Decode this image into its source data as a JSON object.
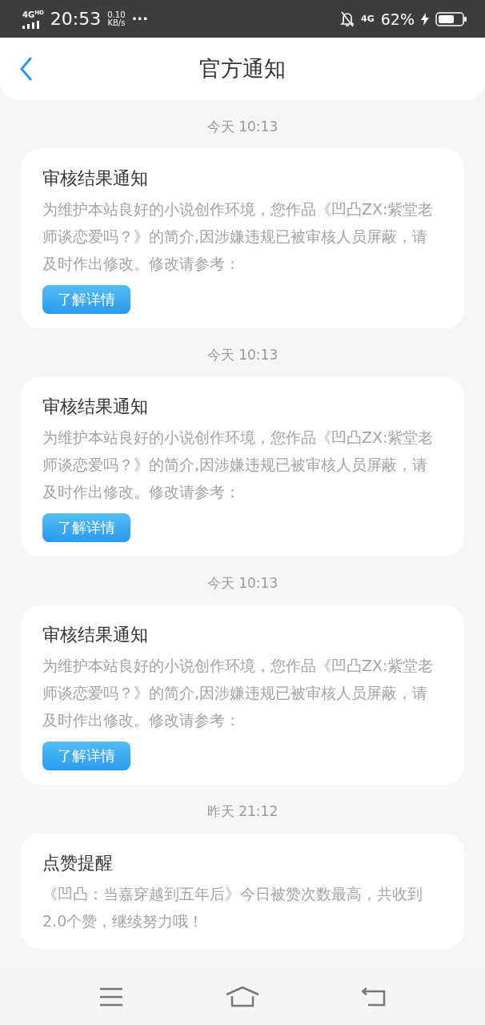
{
  "status_bar": {
    "network": "4G",
    "network_badge": "HD",
    "time": "20:53",
    "speed_value": "0.10",
    "speed_unit": "KB/s",
    "more": "···",
    "data_label": "4G",
    "battery": "62%"
  },
  "header": {
    "title": "官方通知"
  },
  "notifications": [
    {
      "time": "今天 10:13",
      "title": "审核结果通知",
      "body": "为维护本站良好的小说创作环境，您作品《凹凸ZX:紫堂老师谈恋爱吗？》的简介,因涉嫌违规已被审核人员屏蔽，请及时作出修改。修改请参考：",
      "button": "了解详情"
    },
    {
      "time": "今天 10:13",
      "title": "审核结果通知",
      "body": "为维护本站良好的小说创作环境，您作品《凹凸ZX:紫堂老师谈恋爱吗？》的简介,因涉嫌违规已被审核人员屏蔽，请及时作出修改。修改请参考：",
      "button": "了解详情"
    },
    {
      "time": "今天 10:13",
      "title": "审核结果通知",
      "body": "为维护本站良好的小说创作环境，您作品《凹凸ZX:紫堂老师谈恋爱吗？》的简介,因涉嫌违规已被审核人员屏蔽，请及时作出修改。修改请参考：",
      "button": "了解详情"
    },
    {
      "time": "昨天 21:12",
      "title": "点赞提醒",
      "body": "《凹凸：当嘉穿越到五年后》今日被赞次数最高，共收到2.0个赞，继续努力哦！"
    }
  ]
}
